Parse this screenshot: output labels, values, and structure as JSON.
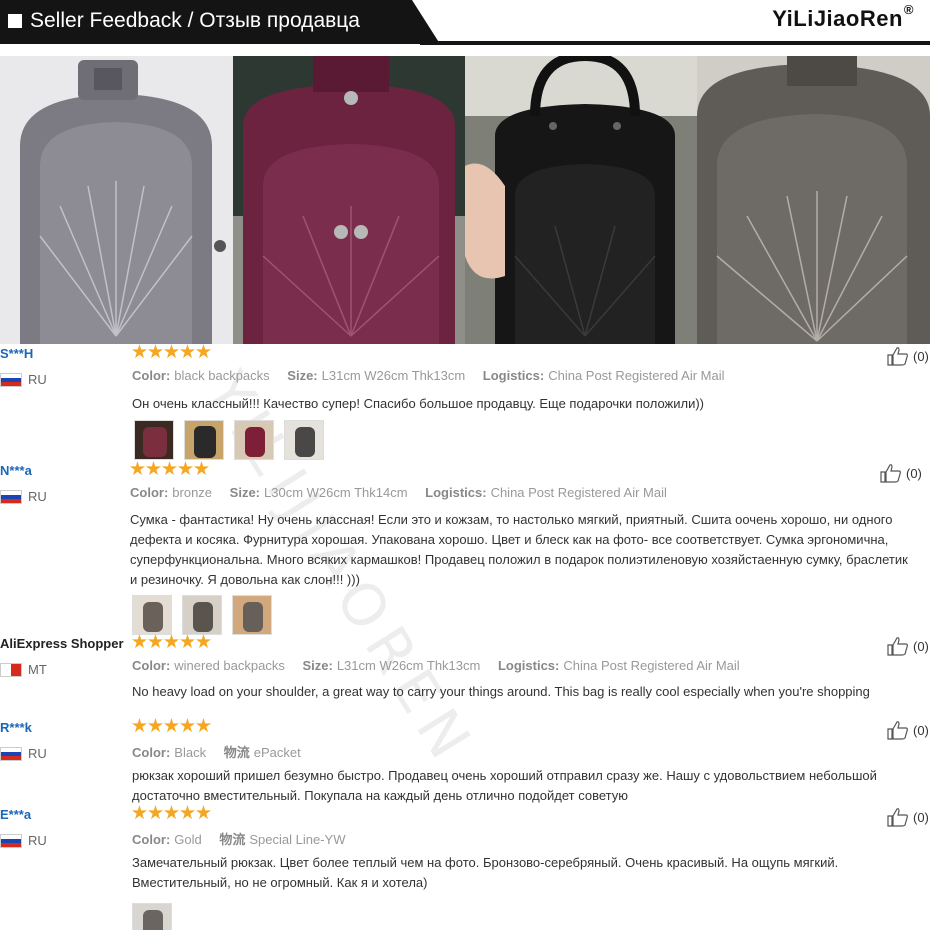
{
  "header": {
    "title": "Seller Feedback / Отзыв продавца",
    "brand": "YiLiJiaoRen",
    "brand_mark": "®"
  },
  "watermark": "YILIJIAOREN",
  "colors": {
    "link_blue": "#1a66b8",
    "star": "#f5a623",
    "header_bg": "#141414"
  },
  "reviews": [
    {
      "user": "S***H",
      "country": "RU",
      "meta": [
        {
          "label": "Color:",
          "value": "black backpacks"
        },
        {
          "label": "Size:",
          "value": "L31cm W26cm Thk13cm"
        },
        {
          "label": "Logistics:",
          "value": "China Post Registered Air Mail"
        }
      ],
      "text": "Он очень классный!!! Качество супер! Спасибо большое продавцу. Еще подарочки положили))",
      "likes": "(0)",
      "thumbs": 4
    },
    {
      "user": "N***a",
      "country": "RU",
      "meta": [
        {
          "label": "Color:",
          "value": "bronze"
        },
        {
          "label": "Size:",
          "value": "L30cm W26cm Thk14cm"
        },
        {
          "label": "Logistics:",
          "value": "China Post Registered Air Mail"
        }
      ],
      "text": "Сумка - фантастика! Ну очень классная! Если это и кожзам, то настолько мягкий, приятный. Сшита оочень хорошо, ни одного дефекта и косяка. Фурнитура хорошая. Упакована хорошо. Цвет и блеск как на фото- все соответствует. Сумка эргономична, суперфункциональна. Много всяких кармашков! Продавец положил в подарок полиэтиленовую хозяйстаенную сумку, браслетик и резиночку. Я довольна как слон!!! )))",
      "likes": "(0)",
      "thumbs": 3
    },
    {
      "user": "AliExpress Shopper",
      "country": "MT",
      "meta": [
        {
          "label": "Color:",
          "value": "winered backpacks"
        },
        {
          "label": "Size:",
          "value": "L31cm W26cm Thk13cm"
        },
        {
          "label": "Logistics:",
          "value": "China Post Registered Air Mail"
        }
      ],
      "text": "No heavy load on your shoulder, a great way to carry your things around. This bag is really cool especially when you're shopping",
      "likes": "(0)",
      "thumbs": 0
    },
    {
      "user": "R***k",
      "country": "RU",
      "meta": [
        {
          "label": "Color:",
          "value": "Black"
        },
        {
          "label": "物流",
          "value": "ePacket"
        }
      ],
      "text": "рюкзак хороший пришел безумно быстро. Продавец очень хороший отправил сразу же. Нашу с удовольствием небольшой достаточно вместительный. Покупала на каждый день отлично подойдет советую",
      "likes": "(0)",
      "thumbs": 0
    },
    {
      "user": "E***a",
      "country": "RU",
      "meta": [
        {
          "label": "Color:",
          "value": "Gold"
        },
        {
          "label": "物流",
          "value": "Special Line-YW"
        }
      ],
      "text": "Замечательный рюкзак. Цвет более теплый чем на фото. Бронзово-серебряный. Очень красивый. На ощупь мягкий. Вместительный, но не огромный. Как я и хотела)",
      "likes": "(0)",
      "thumbs": 1
    }
  ]
}
